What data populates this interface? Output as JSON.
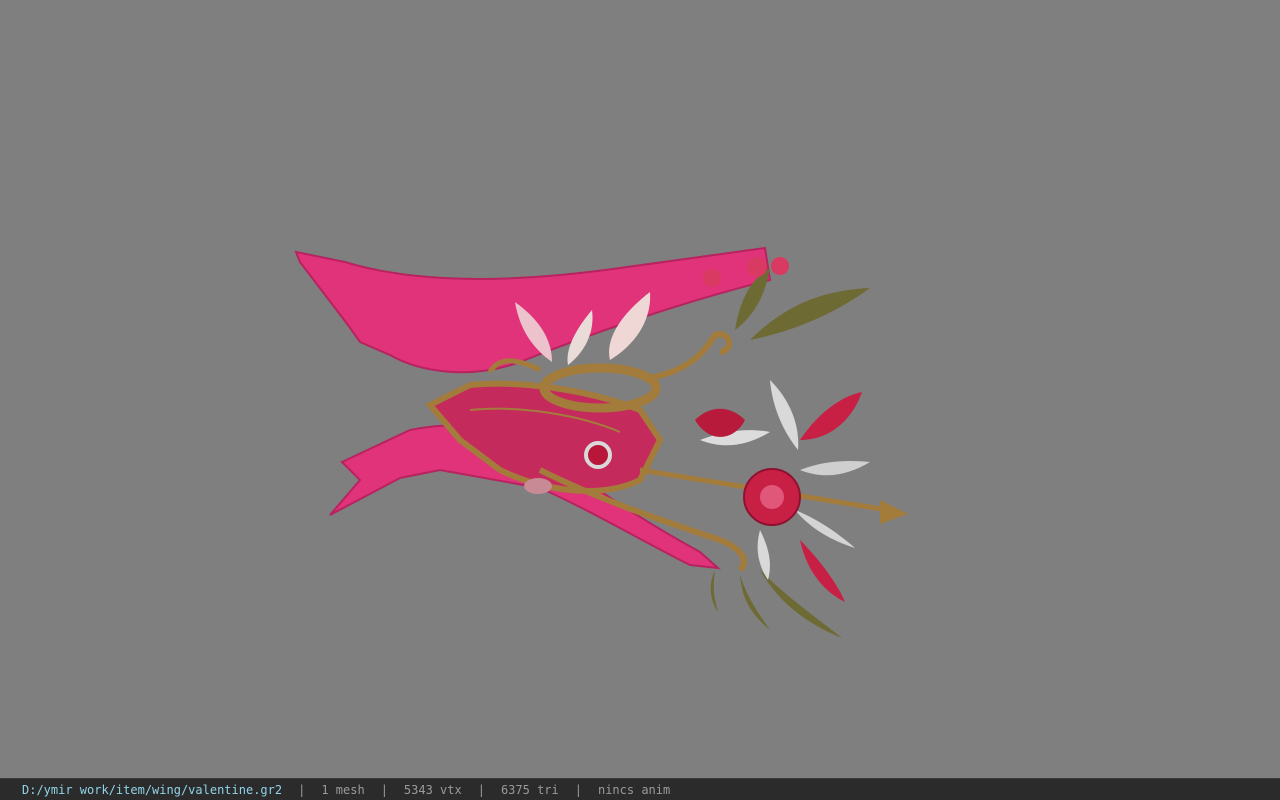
{
  "status_bar": {
    "file_path": "D:/ymir work/item/wing/valentine.gr2",
    "separator": "|",
    "mesh_count": "1 mesh",
    "vertex_count": "5343 vtx",
    "triangle_count": "6375 tri",
    "animation": "nincs anim"
  },
  "colors": {
    "viewport_background": "#7f7f7f",
    "status_bar_background": "#2b2b2b",
    "path_text": "#8fd3e8",
    "info_text": "#9a9a9a",
    "ribbon_pink": "#e0337a",
    "gold_frame": "#a37c3c",
    "rose_red": "#c81f45",
    "silver_leaf": "#d9d9d9",
    "leaf_green": "#6e6a34"
  }
}
